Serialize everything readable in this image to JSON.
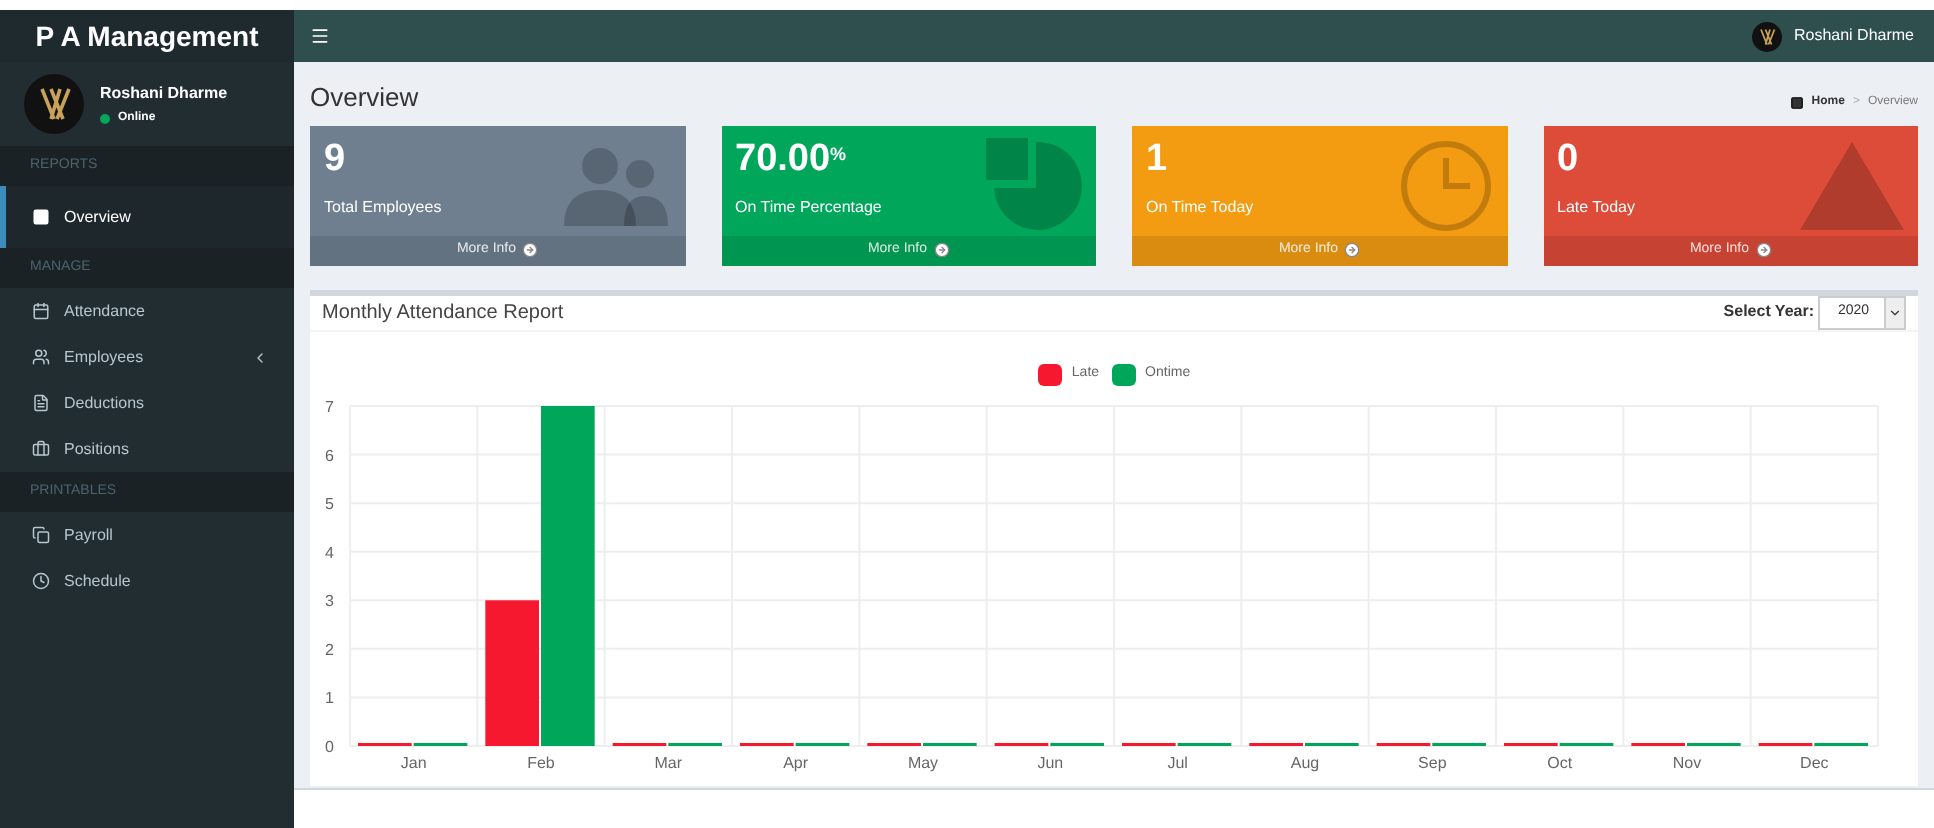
{
  "sidebar": {
    "brand": "P A Management",
    "user": {
      "name": "Roshani Dharme",
      "status": "Online"
    },
    "sections": [
      {
        "header": "REPORTS",
        "items": [
          {
            "label": "Overview",
            "selected": true,
            "expandable": false
          }
        ]
      },
      {
        "header": "MANAGE",
        "items": [
          {
            "label": "Attendance",
            "selected": false,
            "expandable": false
          },
          {
            "label": "Employees",
            "selected": false,
            "expandable": true
          },
          {
            "label": "Deductions",
            "selected": false,
            "expandable": false
          },
          {
            "label": "Positions",
            "selected": false,
            "expandable": false
          }
        ]
      },
      {
        "header": "PRINTABLES",
        "items": [
          {
            "label": "Payroll",
            "selected": false,
            "expandable": false
          },
          {
            "label": "Schedule",
            "selected": false,
            "expandable": false
          }
        ]
      }
    ]
  },
  "topbar": {
    "user_name": "Roshani Dharme"
  },
  "page": {
    "title": "Overview",
    "breadcrumb": [
      "Home",
      "Overview"
    ],
    "breadcrumb_separator": ">"
  },
  "stat_cards": [
    {
      "value": "9",
      "label": "Total Employees",
      "footer": "More Info",
      "color": "#6f7f8f"
    },
    {
      "value": "70.00",
      "suffix": "%",
      "label": "On Time Percentage",
      "footer": "More Info",
      "color": "#00a65a"
    },
    {
      "value": "1",
      "label": "On Time Today",
      "footer": "More Info",
      "color": "#f39c12"
    },
    {
      "value": "0",
      "label": "Late Today",
      "footer": "More Info",
      "color": "#dd4b39"
    }
  ],
  "report": {
    "title": "Monthly Attendance Report",
    "year_label": "Select Year:",
    "year_value": "2020",
    "chart_data": {
      "type": "bar",
      "categories": [
        "Jan",
        "Feb",
        "Mar",
        "Apr",
        "May",
        "Jun",
        "Jul",
        "Aug",
        "Sep",
        "Oct",
        "Nov",
        "Dec"
      ],
      "series": [
        {
          "name": "Late",
          "color": "#f5182e",
          "values": [
            0,
            3,
            0,
            0,
            0,
            0,
            0,
            0,
            0,
            0,
            0,
            0
          ]
        },
        {
          "name": "Ontime",
          "color": "#00a65a",
          "values": [
            0,
            7,
            0,
            0,
            0,
            0,
            0,
            0,
            0,
            0,
            0,
            0
          ]
        }
      ],
      "ylim": [
        0,
        7
      ],
      "grid": true,
      "yticks": [
        0,
        1,
        2,
        3,
        4,
        5,
        6,
        7
      ]
    }
  }
}
